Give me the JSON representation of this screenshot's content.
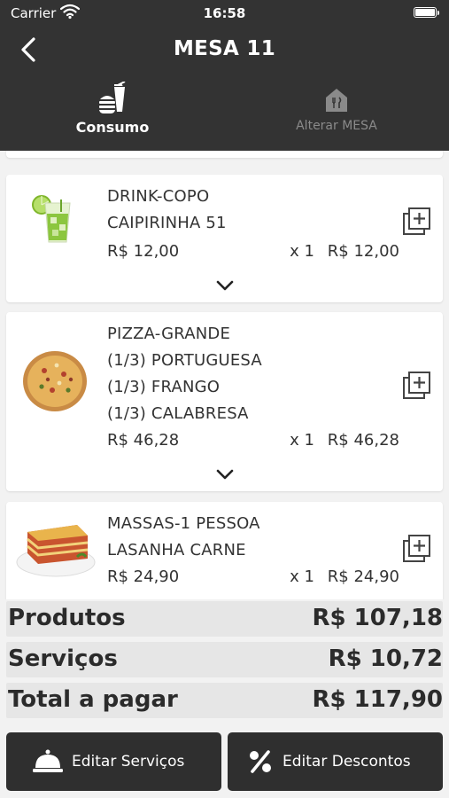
{
  "status_bar": {
    "carrier": "Carrier",
    "time": "16:58"
  },
  "header": {
    "title": "MESA 11"
  },
  "tabs": [
    {
      "label": "Consumo",
      "icon": "burger-drink-icon",
      "active": true
    },
    {
      "label": "Alterar MESA",
      "icon": "table-house-icon",
      "active": false
    }
  ],
  "items": [
    {
      "lines": [
        "DRINK-COPO",
        "CAIPIRINHA 51"
      ],
      "unit_price": "R$ 12,00",
      "qty": "x 1",
      "total": "R$ 12,00",
      "image": "caipirinha-image"
    },
    {
      "lines": [
        "PIZZA-GRANDE",
        "(1/3) PORTUGUESA",
        "(1/3) FRANGO",
        "(1/3) CALABRESA"
      ],
      "unit_price": "R$ 46,28",
      "qty": "x 1",
      "total": "R$ 46,28",
      "image": "pizza-image"
    },
    {
      "lines": [
        "MASSAS-1 PESSOA",
        "LASANHA CARNE"
      ],
      "unit_price": "R$ 24,90",
      "qty": "x 1",
      "total": "R$ 24,90",
      "image": "lasagna-image"
    }
  ],
  "summary": {
    "produtos_label": "Produtos",
    "produtos_value": "R$ 107,18",
    "servicos_label": "Serviços",
    "servicos_value": "R$ 10,72",
    "total_label": "Total a pagar",
    "total_value": "R$ 117,90"
  },
  "actions": {
    "servicos_label": "Editar Serviços",
    "descontos_label": "Editar Descontos"
  },
  "colors": {
    "header_bg": "#333333",
    "button_bg": "#2f2f2f",
    "summary_bg": "#e6e6e6"
  }
}
